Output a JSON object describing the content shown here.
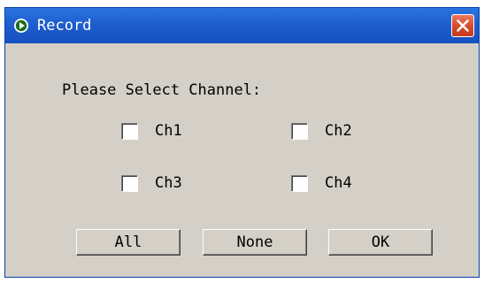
{
  "window": {
    "title": "Record",
    "close_icon": "close-icon"
  },
  "prompt": "Please Select Channel:",
  "channels": [
    {
      "label": "Ch1",
      "checked": false
    },
    {
      "label": "Ch2",
      "checked": false
    },
    {
      "label": "Ch3",
      "checked": false
    },
    {
      "label": "Ch4",
      "checked": false
    }
  ],
  "buttons": {
    "all": "All",
    "none": "None",
    "ok": "OK"
  }
}
